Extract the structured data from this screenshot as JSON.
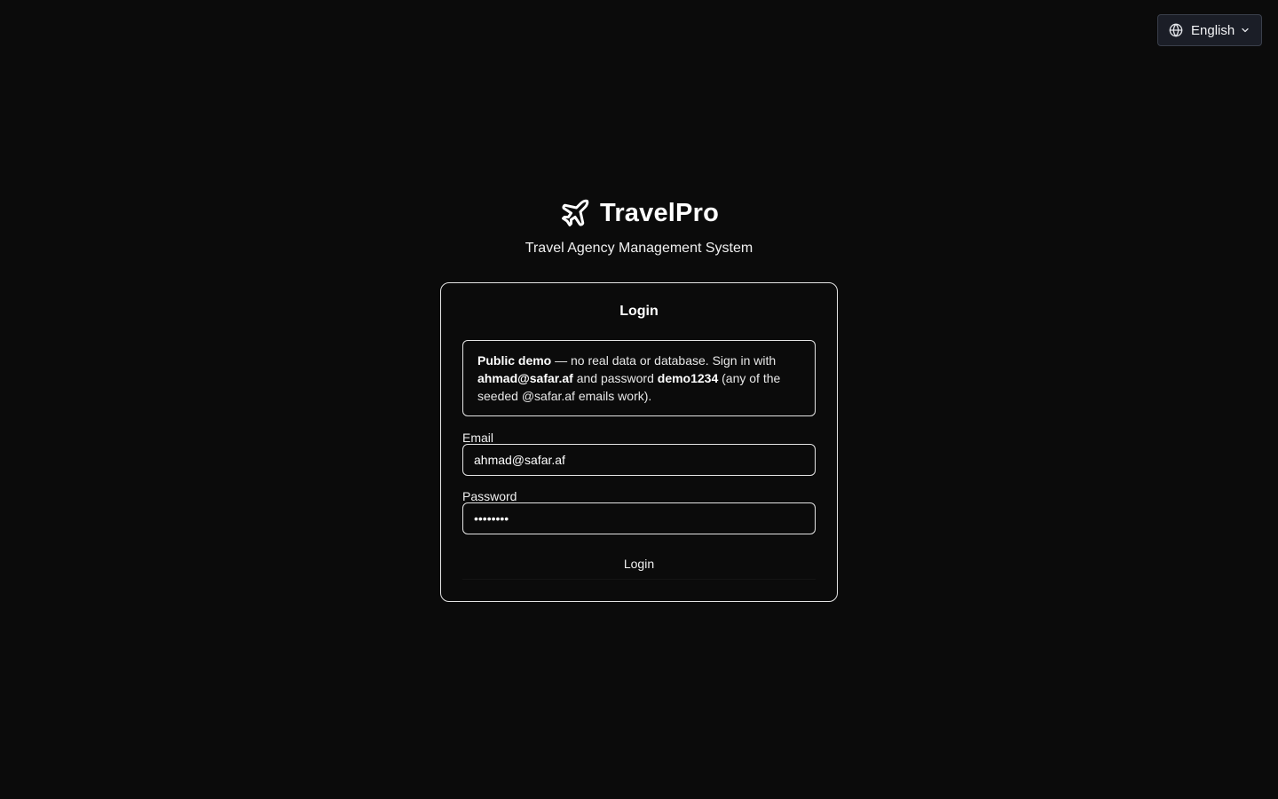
{
  "language_selector": {
    "label": "English",
    "icon": "globe-icon",
    "dropdown_icon": "chevron-down-icon"
  },
  "brand": {
    "name": "TravelPro",
    "icon": "plane-icon",
    "tagline": "Travel Agency Management System"
  },
  "login_card": {
    "title": "Login",
    "notice": {
      "part1_bold": "Public demo",
      "part2": " — no real data or database. Sign in with ",
      "part3_bold": "ahmad@safar.af",
      "part4": " and password ",
      "part5_bold": "demo1234",
      "part6": " (any of the seeded @safar.af emails work)."
    },
    "email": {
      "label": "Email",
      "value": "ahmad@safar.af"
    },
    "password": {
      "label": "Password",
      "value": "demo1234"
    },
    "submit_label": "Login"
  },
  "colors": {
    "background": "#0b0b0b",
    "border": "#e5e5e5",
    "selector_bg": "#1b1e27",
    "text": "#ffffff"
  }
}
